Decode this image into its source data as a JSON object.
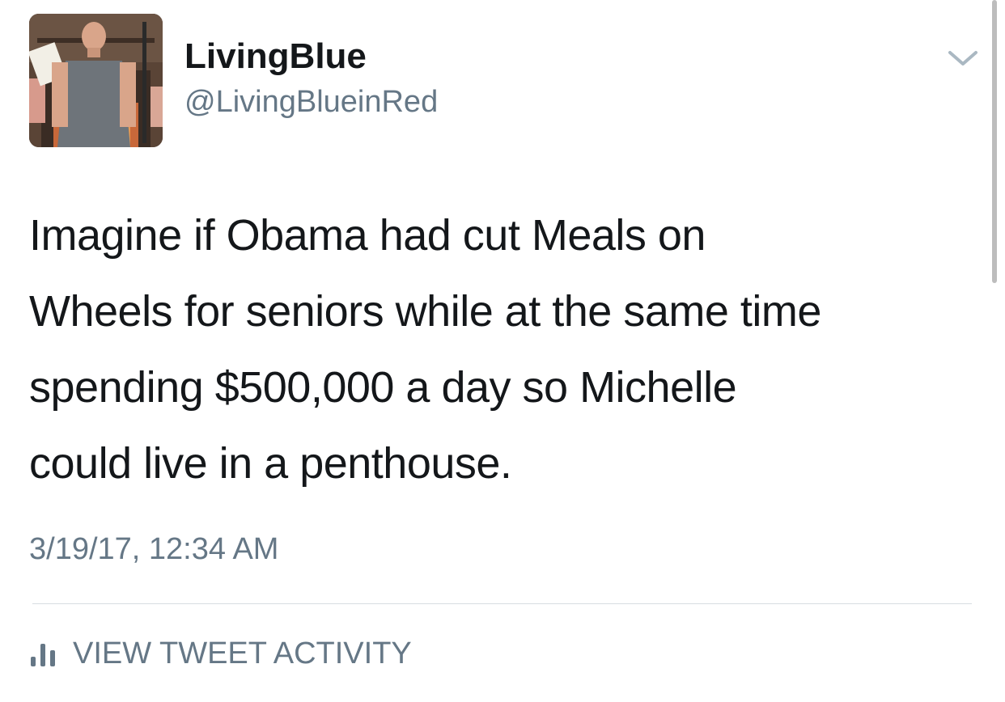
{
  "user": {
    "display_name": "LivingBlue",
    "handle": "@LivingBlueinRed",
    "avatar": "profile-photo"
  },
  "tweet": {
    "lines": [
      "Imagine if Obama had cut Meals on",
      "Wheels for seniors while at the same time",
      "spending $500,000 a day so Michelle",
      "could live in a penthouse."
    ],
    "timestamp": "3/19/17, 12:34 AM"
  },
  "actions": {
    "menu_icon": "chevron-down-icon",
    "activity_icon": "bar-chart-icon",
    "activity_label": "VIEW TWEET ACTIVITY"
  },
  "colors": {
    "primary_text": "#14171a",
    "secondary_text": "#657786",
    "divider": "#d8dde1",
    "background": "#ffffff"
  }
}
